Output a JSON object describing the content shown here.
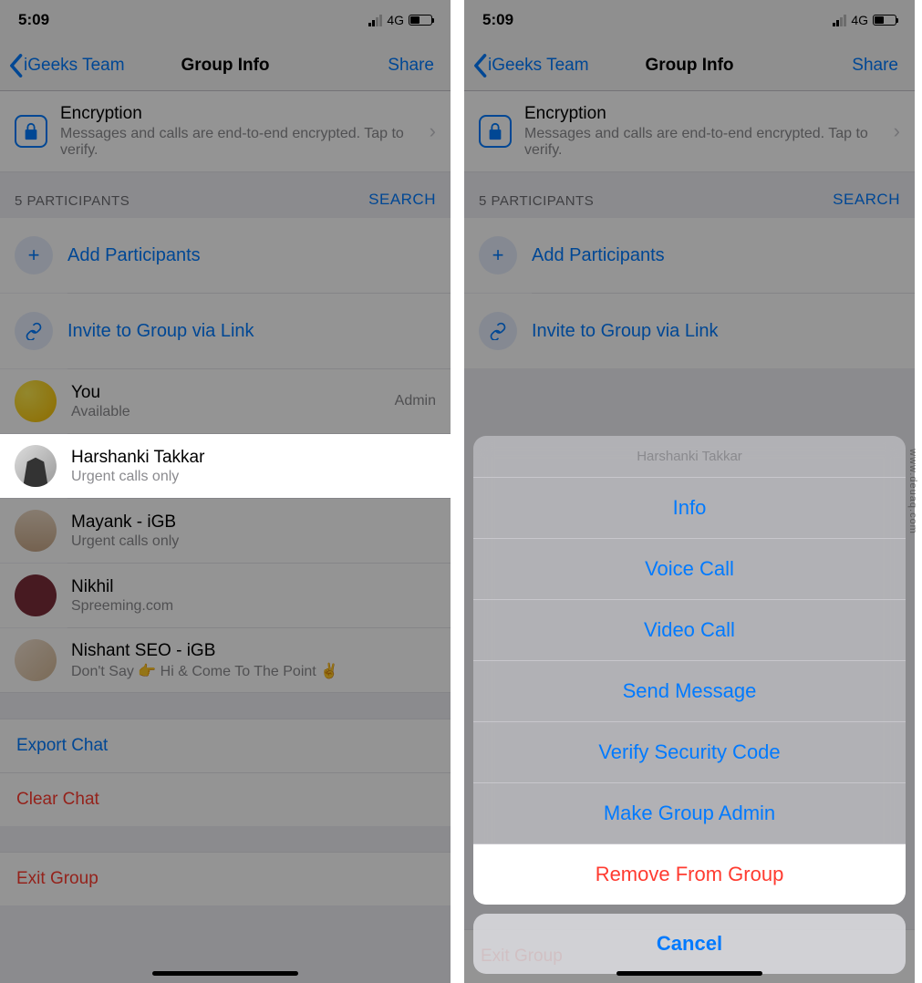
{
  "status": {
    "time": "5:09",
    "network": "4G"
  },
  "nav": {
    "back": "iGeeks Team",
    "title": "Group Info",
    "share": "Share"
  },
  "encryption": {
    "title": "Encryption",
    "subtitle": "Messages and calls are end-to-end encrypted. Tap to verify."
  },
  "participants_header": {
    "count_label": "5 PARTICIPANTS",
    "search": "SEARCH"
  },
  "actions": {
    "add": "Add Participants",
    "invite": "Invite to Group via Link"
  },
  "participants": [
    {
      "name": "You",
      "status": "Available",
      "role": "Admin"
    },
    {
      "name": "Harshanki Takkar",
      "status": "Urgent calls only",
      "role": ""
    },
    {
      "name": "Mayank - iGB",
      "status": "Urgent calls only",
      "role": ""
    },
    {
      "name": "Nikhil",
      "status": "Spreeming.com",
      "role": ""
    },
    {
      "name": "Nishant SEO - iGB",
      "status": "Don't Say 👉 Hi & Come To The Point ✌️",
      "role": ""
    }
  ],
  "footer": {
    "export": "Export Chat",
    "clear": "Clear Chat",
    "exit": "Exit Group"
  },
  "sheet": {
    "title": "Harshanki Takkar",
    "options": {
      "info": "Info",
      "voice": "Voice Call",
      "video": "Video Call",
      "message": "Send Message",
      "verify": "Verify Security Code",
      "admin": "Make Group Admin",
      "remove": "Remove From Group"
    },
    "cancel": "Cancel"
  },
  "watermark": "www.deuaq.com"
}
